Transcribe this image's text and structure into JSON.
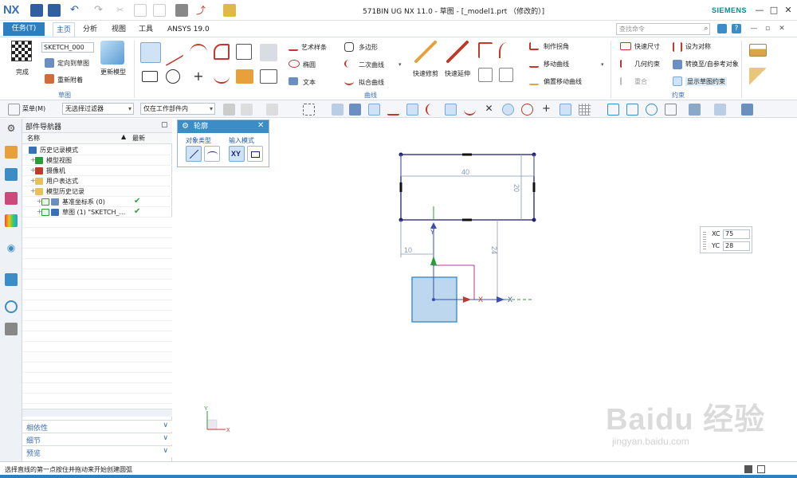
{
  "app": {
    "logo": "NX",
    "window_title": "571BIN UG NX 11.0 - 草图 - [_model1.prt （修改的）]",
    "brand": "SIEMENS",
    "win_controls": [
      "—",
      "□",
      "✕"
    ]
  },
  "tabs": {
    "task": "任务(T)",
    "items": [
      "主页",
      "分析",
      "视图",
      "工具",
      "ANSYS 19.0"
    ],
    "active": "主页",
    "search_placeholder": "查找命令"
  },
  "ribbon": {
    "sketch_group": {
      "label": "草图",
      "finish": "完成",
      "sketch_name": "SKETCH_000",
      "orient": "定向到草图",
      "reattach": "重新附着",
      "update_model": "更新模型"
    },
    "curve_group": {
      "label": "曲线",
      "items": [
        "艺术样条",
        "多边形",
        "椭圆",
        "二次曲线",
        "文本",
        "拟合曲线"
      ],
      "quick_trim": "快速修剪",
      "quick_extend": "快速延伸",
      "make_corner": "制作拐角",
      "move_curve": "移动曲线",
      "offset_move_curve": "偏置移动曲线"
    },
    "constraint_group": {
      "label": "约束",
      "rapid_dim": "快速尺寸",
      "geo_constraint": "几何约束",
      "coincident": "重合",
      "make_symmetric": "设为对称",
      "convert_ref": "转换至/自参考对象",
      "show_sketch_constraints": "显示草图约束"
    }
  },
  "toolbar2": {
    "menu": "菜单(M)",
    "filter": "无选择过滤器",
    "scope": "仅在工作部件内"
  },
  "navigator": {
    "title": "部件导航器",
    "col_name": "名称",
    "col_latest": "最新",
    "rows": [
      {
        "label": "历史记录模式",
        "indent": 0,
        "check": false
      },
      {
        "label": "模型视图",
        "indent": 1,
        "check": false
      },
      {
        "label": "摄像机",
        "indent": 1,
        "check": false
      },
      {
        "label": "用户表达式",
        "indent": 1,
        "check": false
      },
      {
        "label": "模型历史记录",
        "indent": 1,
        "check": false
      },
      {
        "label": "基准坐标系 (0)",
        "indent": 2,
        "check": true
      },
      {
        "label": "草图 (1) \"SKETCH_...",
        "indent": 2,
        "check": true
      }
    ],
    "sections": [
      "相依性",
      "细节",
      "预览"
    ]
  },
  "profile_dialog": {
    "title": "轮廓",
    "object_type": "对象类型",
    "input_mode": "输入模式",
    "xy_label": "XY"
  },
  "sketch": {
    "dim_width": "40",
    "dim_height": "20",
    "dim_left": "10",
    "dim_vertical": "24",
    "axis_x": "X",
    "axis_y": "Y",
    "triad_x": "X",
    "triad_y": "Y"
  },
  "coord_input": {
    "xc_label": "XC",
    "xc_value": "75",
    "yc_label": "YC",
    "yc_value": "28"
  },
  "status": {
    "text": "选择直线的第一点按住并拖动来开始创建圆弧"
  },
  "watermark": {
    "main": "Baidu 经验",
    "sub": "jingyan.baidu.com"
  }
}
